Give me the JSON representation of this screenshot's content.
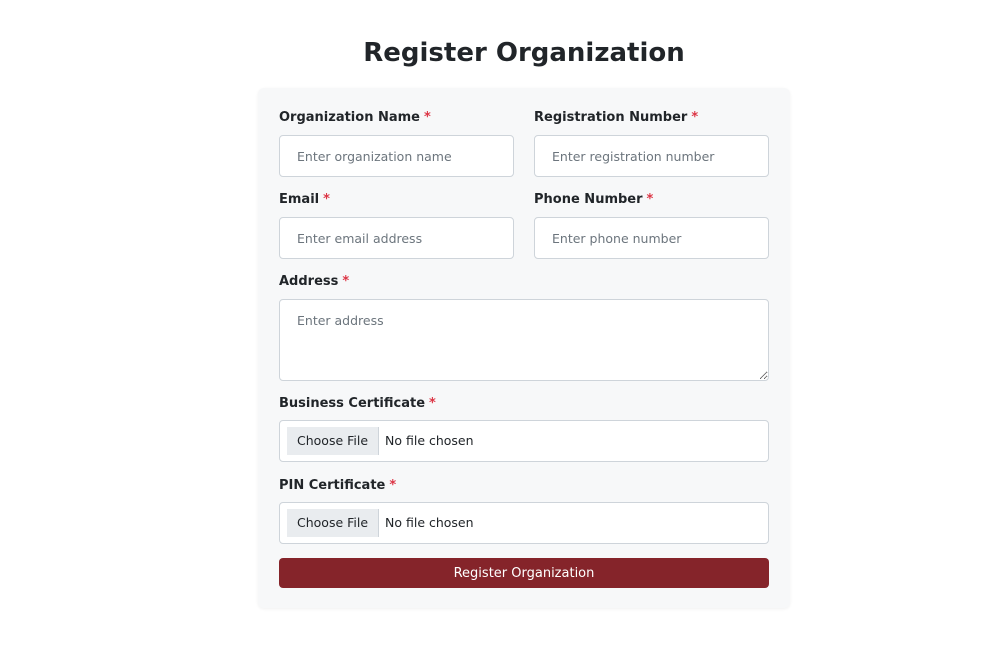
{
  "page": {
    "title": "Register Organization"
  },
  "form": {
    "required_marker": "*",
    "organization_name": {
      "label": "Organization Name",
      "placeholder": "Enter organization name",
      "value": ""
    },
    "registration_number": {
      "label": "Registration Number",
      "placeholder": "Enter registration number",
      "value": ""
    },
    "email": {
      "label": "Email",
      "placeholder": "Enter email address",
      "value": ""
    },
    "phone_number": {
      "label": "Phone Number",
      "placeholder": "Enter phone number",
      "value": ""
    },
    "address": {
      "label": "Address",
      "placeholder": "Enter address",
      "value": ""
    },
    "business_certificate": {
      "label": "Business Certificate",
      "button_label": "Choose File",
      "status": "No file chosen"
    },
    "pin_certificate": {
      "label": "PIN Certificate",
      "button_label": "Choose File",
      "status": "No file chosen"
    },
    "submit_label": "Register Organization"
  },
  "colors": {
    "accent": "#85242a",
    "required": "#dc3545",
    "card_background": "#f7f8f9"
  },
  "icons": {
    "resize_handle": "resize-grip-icon"
  }
}
